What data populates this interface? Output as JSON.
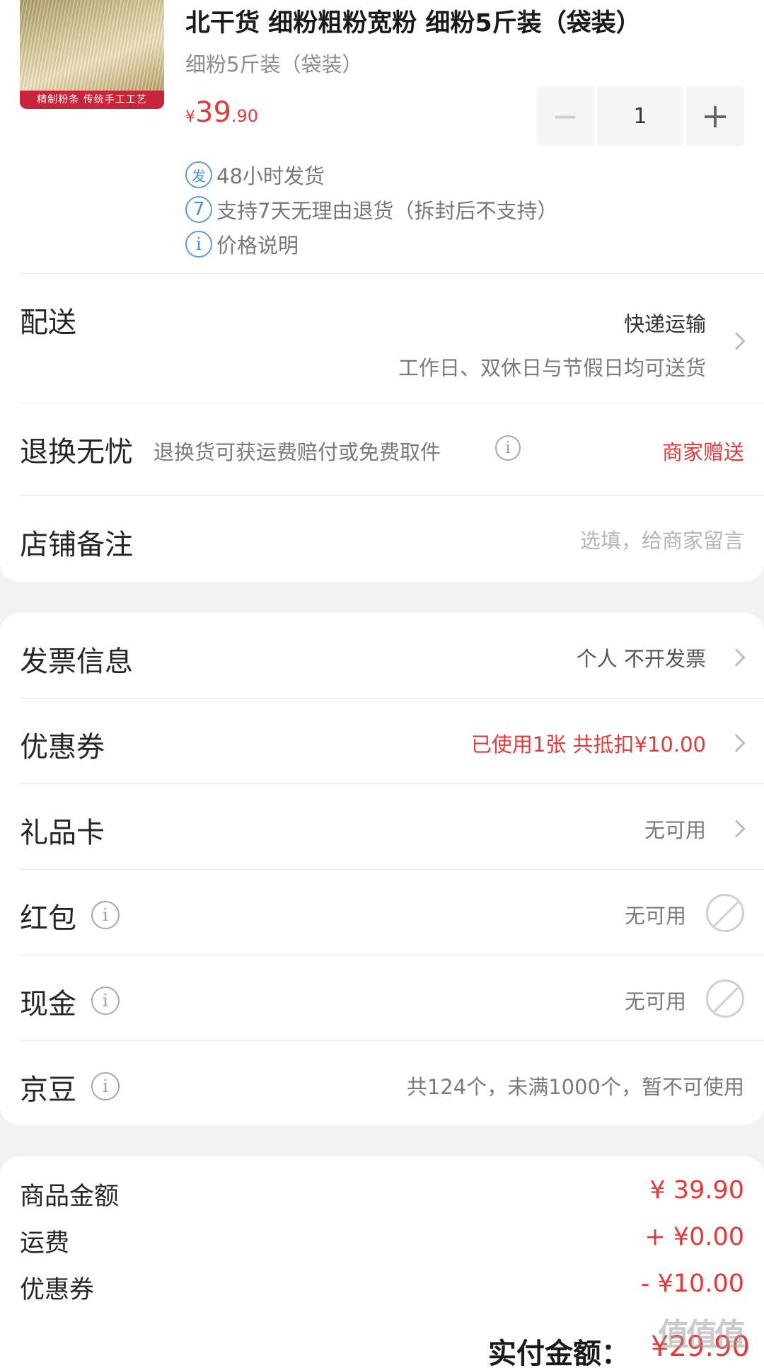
{
  "product": {
    "thumb_caption": "精制粉条 传统手工工艺",
    "title": "北干货 细粉粗粉宽粉 细粉5斤装（袋装）",
    "spec": "细粉5斤装（袋装）",
    "price_currency": "¥",
    "price_int": "39",
    "price_dec": ".90",
    "quantity": "1",
    "minus_label": "−",
    "plus_label": "+",
    "services": [
      {
        "icon": "发",
        "text": "48小时发货"
      },
      {
        "icon": "7",
        "text": "支持7天无理由退货（拆封后不支持）"
      },
      {
        "icon": "i",
        "text": "价格说明"
      }
    ]
  },
  "delivery": {
    "label": "配送",
    "method": "快递运输",
    "note": "工作日、双休日与节假日均可送货"
  },
  "returns": {
    "label": "退换无忧",
    "desc": "退换货可获运费赔付或免费取件",
    "status": "商家赠送"
  },
  "remark": {
    "label": "店铺备注",
    "placeholder": "选填，给商家留言"
  },
  "invoice": {
    "label": "发票信息",
    "value": "个人 不开发票"
  },
  "coupon": {
    "label": "优惠券",
    "value": "已使用1张 共抵扣¥10.00"
  },
  "giftcard": {
    "label": "礼品卡",
    "value": "无可用"
  },
  "redpacket": {
    "label": "红包",
    "value": "无可用"
  },
  "cash": {
    "label": "现金",
    "value": "无可用"
  },
  "jingdou": {
    "label": "京豆",
    "value": "共124个，未满1000个，暂不可使用"
  },
  "summary": {
    "goods_label": "商品金额",
    "goods_value": "¥ 39.90",
    "freight_label": "运费",
    "freight_value": "+ ¥0.00",
    "coupon_label": "优惠券",
    "coupon_value": "- ¥10.00"
  },
  "total": {
    "label": "实付金额：",
    "value": "¥29.90"
  },
  "watermark": "值值值",
  "colors": {
    "accent_red": "#e23a3a",
    "icon_blue": "#4a8ad8"
  }
}
